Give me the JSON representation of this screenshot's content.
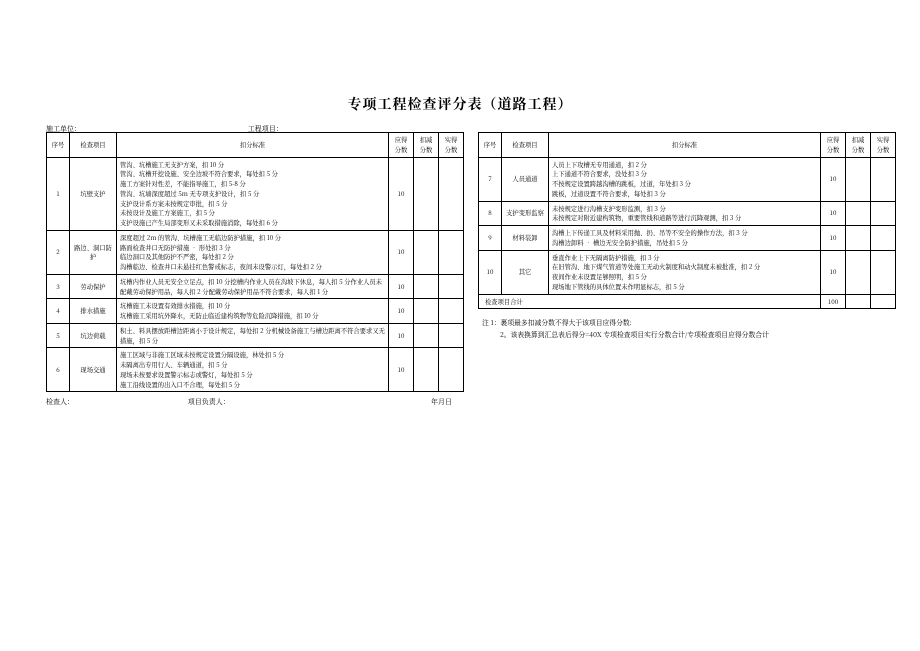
{
  "title": "专项工程检查评分表（道路工程）",
  "header": {
    "unit_lbl": "施工单位：",
    "proj_lbl": "工程项目："
  },
  "cols": {
    "idx": "序号",
    "item": "检查项目",
    "std": "扣分标准",
    "s1": "应得分数",
    "s2": "扣减分数",
    "s3": "实得分数"
  },
  "left_rows": [
    {
      "idx": "1",
      "item": "坑壁支护",
      "std": "管沟、坑槽施工无支护方案，扣 10 分\n管沟、坑槽开挖设施、安全边坡不符合要求，每处扣 5 分\n施工方案针对性差，不能指导施工，扣 5-8 分\n管沟、坑墙深度超过 5m 无专项支护设计，扣 5 分\n支护设计系方案未按规定审批，扣 5 分\n未按设计及施工方案施工，扣 5 分\n支护设施已产生局部变形又未采取措施消除，每处扣 6 分",
      "s1": "10"
    },
    {
      "idx": "2",
      "item": "路边、洞口防护",
      "std": "深度超过 2m 的管沟、坑槽施工无临边防护措施，扣 10 分\n路面检查井口无防护措施 • 形处扣 3 分\n临边洞口及其他防护不严密，每处扣 2 分\n沟槽临边、检查井口未悬挂红色警戒标志，夜间未设警示灯，每处扣 2 分",
      "s1": "10"
    },
    {
      "idx": "3",
      "item": "劳动保护",
      "std": "坑槽内作业人员无安全立足点，扣 10 分挖槽内作业人员在沟坡下休息，每人扣 5 分作业人员未配戴劳动保护用品，每人扣 2 分配戴劳动保护用品不符合要求，每人扣 1 分",
      "s1": "10"
    },
    {
      "idx": "4",
      "item": "排水措施",
      "std": "坑槽施工未设置有效排水措施，扣 10 分\n坑槽施工采用坑外降水，无防止临近建构筑物等危险沉降措施，扣 10 分",
      "s1": "10"
    },
    {
      "idx": "5",
      "item": "坑边荷载",
      "std": "积土、料具摆放距槽边距离小于设计规定，每处扣 2 分机械设备施工与槽边距离不符合要求又无措施，扣 5 分",
      "s1": "10"
    },
    {
      "idx": "6",
      "item": "现场交通",
      "std": "施工区域与非施工区域未按规定设置分隔设施，林处扣 5 分\n未隔离出专用行人、车辆通道，扣 5 分\n现场未按要求设置警示标志或警灯，每处扣 5 分\n施工沿线设置的出入口不合理，每处扣 5 分",
      "s1": "10"
    }
  ],
  "right_rows": [
    {
      "idx": "7",
      "item": "人员通道",
      "std": "人员上下攻槽无专用通道，扣 2 分\n上下通道不符合要求，没处扣 3 分\n不按规定设置跨越沟槽的跳板，过道，年处扣 3 分\n跳板，过道设置不符合要求，每处扣 3 分",
      "s1": "10"
    },
    {
      "idx": "8",
      "item": "支护变形监察",
      "std": "未按规定进行沟槽支护变形监测，扣 3 分\n未按规定对附近建构筑物，重要管线和道路等进行沉降观测，扣 3 分",
      "s1": "10"
    },
    {
      "idx": "9",
      "item": "材料装卸",
      "std": "沟槽上下传递工具及材料采用抛、扔、吊等不安全的操作方法，扣 3 分\n沟槽边卸料 • 槽边无安全防护措施，吊处扣 5 分",
      "s1": "10"
    },
    {
      "idx": "10",
      "item": "其它",
      "std": "垂直作业上下无隔离防护措施，扣 3 分\n在旧管沟、地下煤气管道等处施工无动火制度和动火制度未被批准，扣 2 分\n夜间作业未设置足够照明，扣 5 分\n现场地下管线的具体位置未作明显标志，扣 5 分",
      "s1": "10"
    }
  ],
  "totals": {
    "label": "检查项目合计",
    "s1": "100"
  },
  "footer": {
    "inspector": "检查人：",
    "leader": "项目负责人：",
    "date": "年月日"
  },
  "notes": {
    "n1": "注 1：裹项最多扣减分数不得大于该项目应得分数:",
    "n2": "2。该表换算到汇总表后得分=40X 专项检查项目实行分数合计/专项检查项目应得分数合计"
  }
}
